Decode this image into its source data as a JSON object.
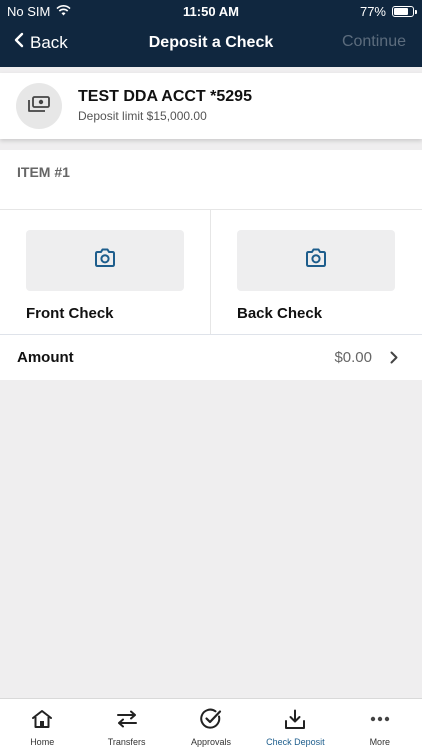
{
  "status_bar": {
    "carrier": "No SIM",
    "time": "11:50 AM",
    "battery": "77%",
    "battery_level": 0.77
  },
  "nav": {
    "back_label": "Back",
    "title": "Deposit a Check",
    "continue_label": "Continue"
  },
  "account": {
    "icon": "money-icon",
    "name": "TEST DDA ACCT *5295",
    "limit": "Deposit limit $15,000.00"
  },
  "item": {
    "header": "ITEM #1",
    "front_label": "Front Check",
    "back_label": "Back Check",
    "camera_icon": "camera-icon"
  },
  "amount": {
    "label": "Amount",
    "value": "$0.00"
  },
  "tabs": [
    {
      "label": "Home",
      "icon": "home-icon",
      "active": false
    },
    {
      "label": "Transfers",
      "icon": "transfer-icon",
      "active": false
    },
    {
      "label": "Approvals",
      "icon": "approvals-icon",
      "active": false
    },
    {
      "label": "Check Deposit",
      "icon": "download-icon",
      "active": true
    },
    {
      "label": "More",
      "icon": "more-icon",
      "active": false
    }
  ],
  "colors": {
    "header_bg": "#10273f",
    "accent": "#1d5d8c",
    "background": "#efeeef"
  }
}
